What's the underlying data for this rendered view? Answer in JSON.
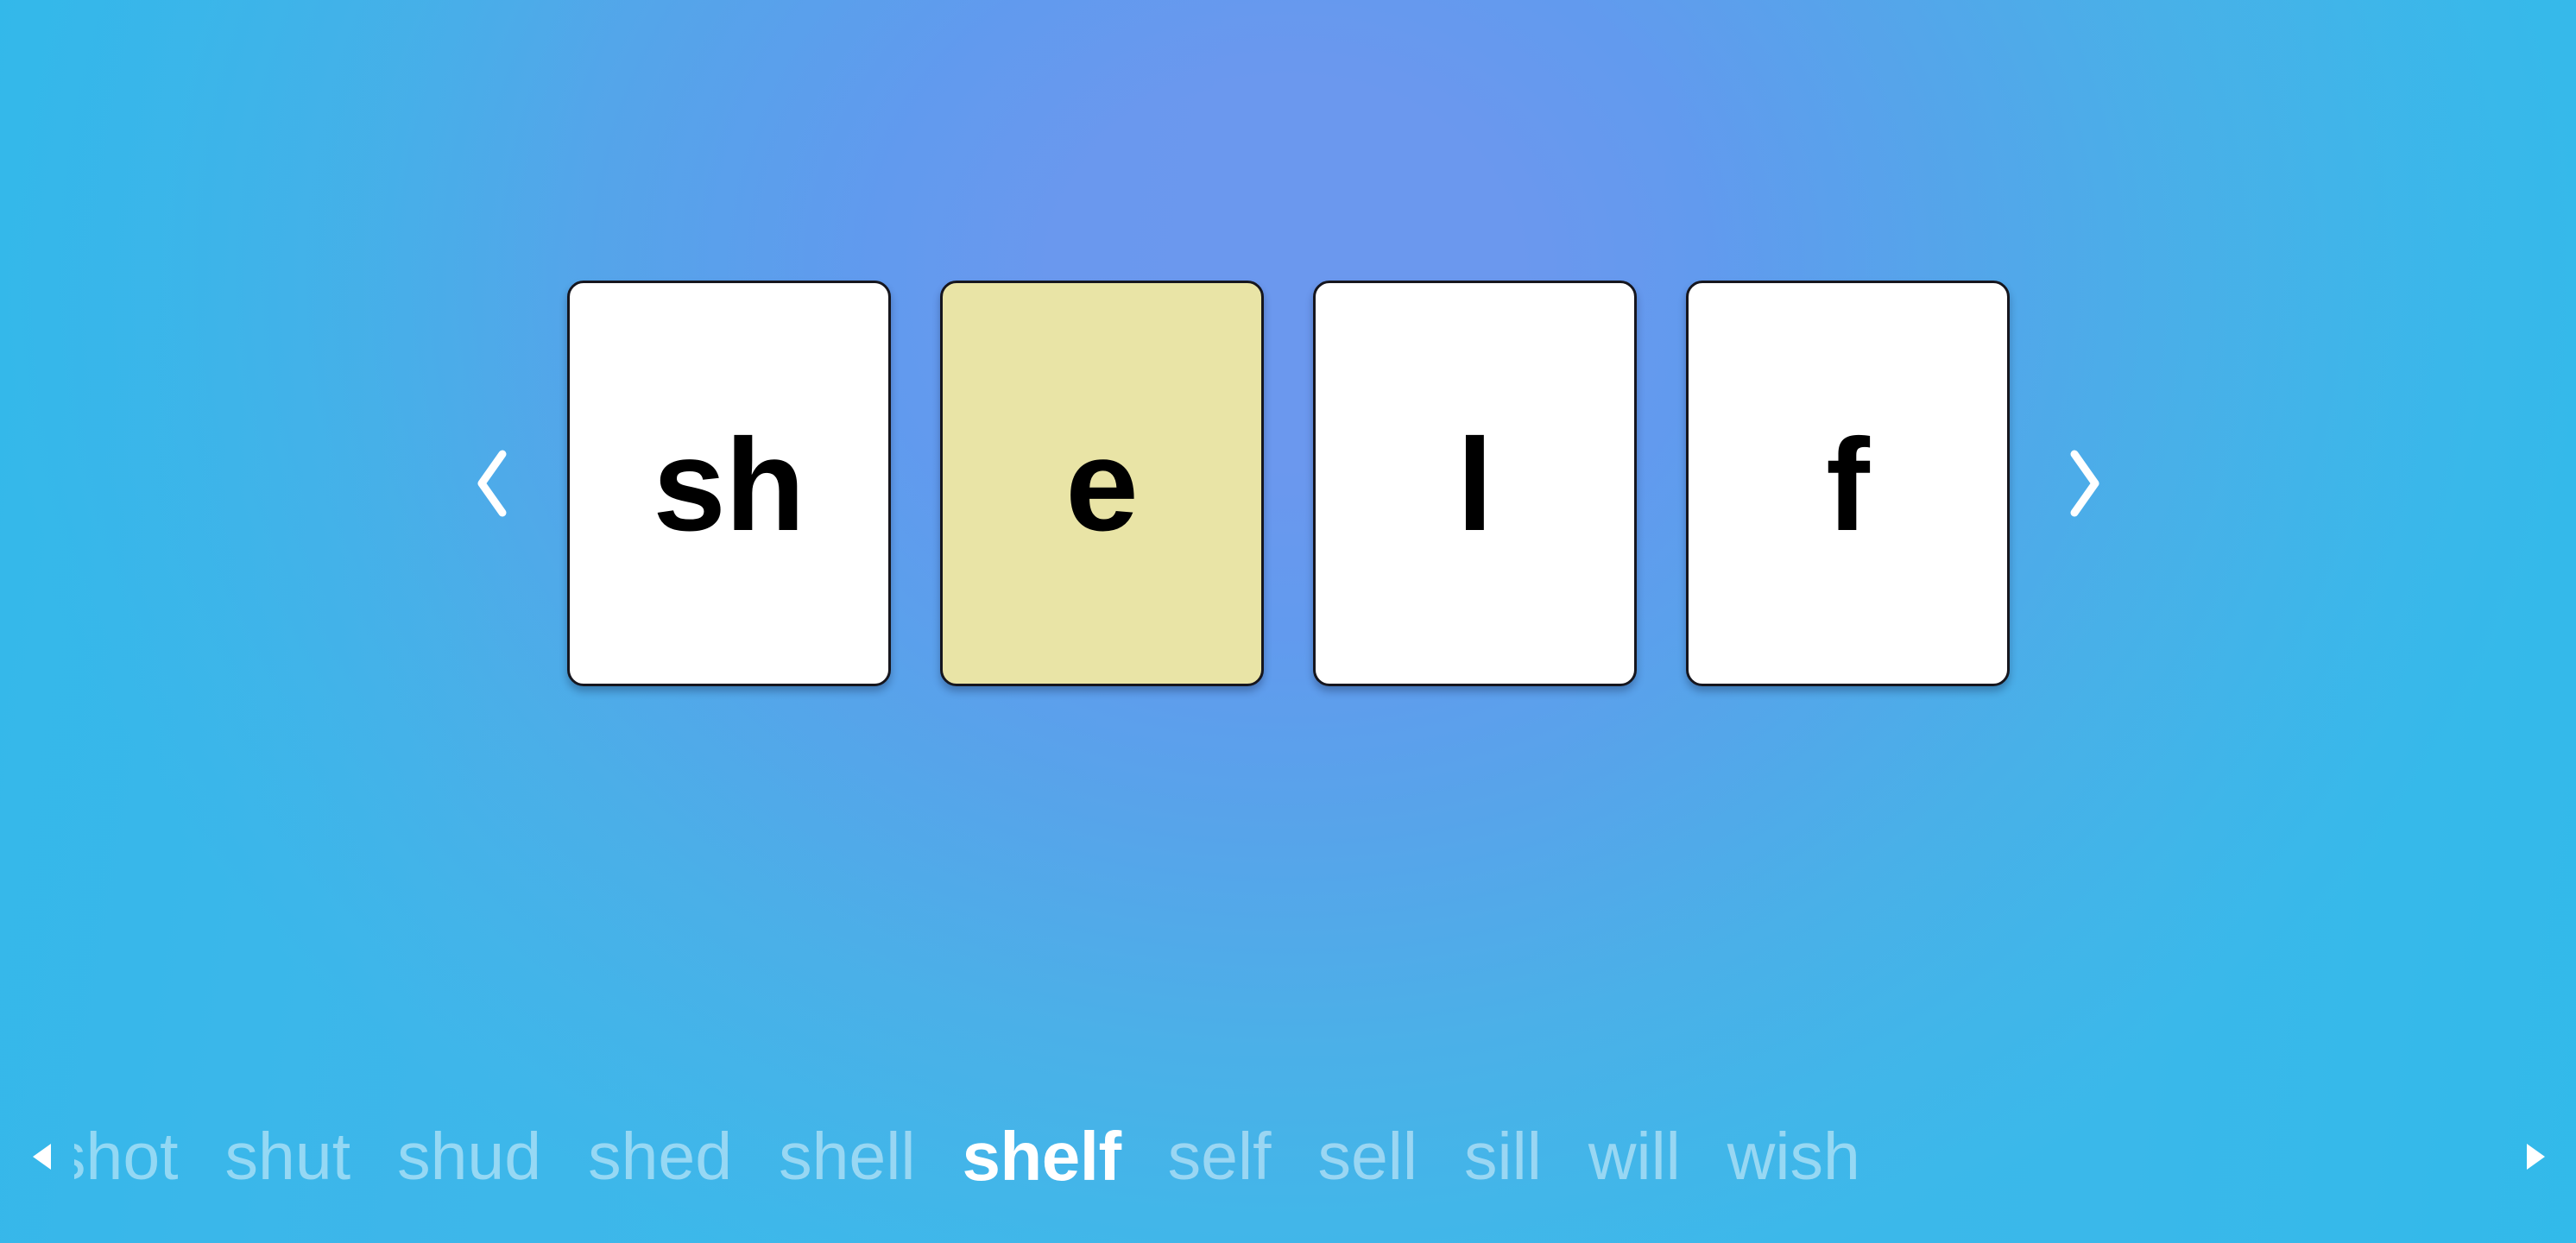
{
  "theme": {
    "background_edge_color": "#3fb6e9",
    "background_center_color": "#6b98ee",
    "card_background": "#ffffff",
    "card_highlight_background": "#e9e4a6",
    "card_border_color": "#16161e",
    "letter_color": "#000000",
    "word_selected_color": "#ffffff",
    "word_muted_color": "rgba(255,255,255,0.46)"
  },
  "word_builder": {
    "current_word": "shelf",
    "prev_button": {
      "label": "‹",
      "name": "previous-card-arrow"
    },
    "next_button": {
      "label": "›",
      "name": "next-card-arrow"
    },
    "cards": [
      {
        "letter": "sh",
        "highlighted": false
      },
      {
        "letter": "e",
        "highlighted": true
      },
      {
        "letter": "l",
        "highlighted": false
      },
      {
        "letter": "f",
        "highlighted": false
      }
    ]
  },
  "word_strip": {
    "scroll_left_label": "◀",
    "scroll_right_label": "▶",
    "selected_word": "shelf",
    "words": [
      {
        "text": "shot",
        "selected": false,
        "clipped": true
      },
      {
        "text": "shut",
        "selected": false,
        "clipped": false
      },
      {
        "text": "shud",
        "selected": false,
        "clipped": false
      },
      {
        "text": "shed",
        "selected": false,
        "clipped": false
      },
      {
        "text": "shell",
        "selected": false,
        "clipped": false
      },
      {
        "text": "shelf",
        "selected": true,
        "clipped": false
      },
      {
        "text": "self",
        "selected": false,
        "clipped": false
      },
      {
        "text": "sell",
        "selected": false,
        "clipped": false
      },
      {
        "text": "sill",
        "selected": false,
        "clipped": false
      },
      {
        "text": "will",
        "selected": false,
        "clipped": false
      },
      {
        "text": "wish",
        "selected": false,
        "clipped": false
      }
    ]
  }
}
